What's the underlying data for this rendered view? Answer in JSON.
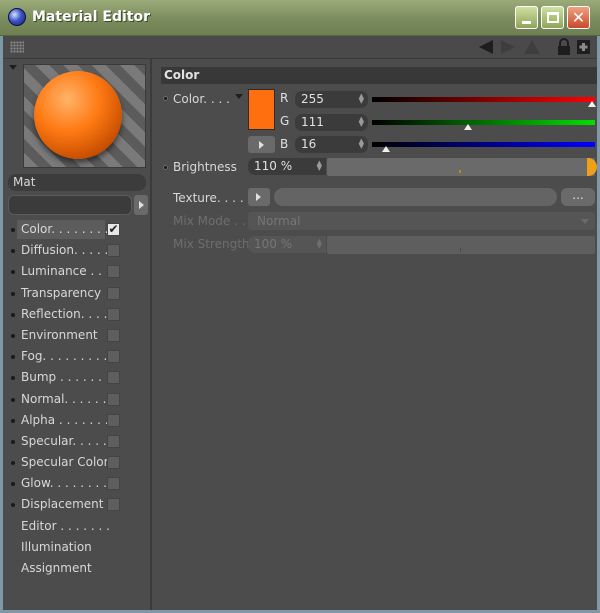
{
  "window": {
    "title": "Material Editor"
  },
  "toolbar": {
    "nav": [
      "back-arrow-icon",
      "forward-arrow-icon",
      "up-arrow-icon",
      "lock-icon",
      "new-window-icon"
    ]
  },
  "material": {
    "name": "Mat"
  },
  "channels": [
    {
      "label": "Color. . . . . . . .",
      "checked": true,
      "selected": true,
      "has_checkbox": true
    },
    {
      "label": "Diffusion. . . . . .",
      "checked": false,
      "has_checkbox": true
    },
    {
      "label": "Luminance . . .",
      "checked": false,
      "has_checkbox": true
    },
    {
      "label": "Transparency",
      "checked": false,
      "has_checkbox": true
    },
    {
      "label": "Reflection. . . .",
      "checked": false,
      "has_checkbox": true
    },
    {
      "label": "Environment",
      "checked": false,
      "has_checkbox": true
    },
    {
      "label": "Fog. . . . . . . . .",
      "checked": false,
      "has_checkbox": true
    },
    {
      "label": "Bump . . . . . . .",
      "checked": false,
      "has_checkbox": true
    },
    {
      "label": "Normal. . . . . .",
      "checked": false,
      "has_checkbox": true
    },
    {
      "label": "Alpha . . . . . . .",
      "checked": false,
      "has_checkbox": true
    },
    {
      "label": "Specular. . . . .",
      "checked": false,
      "has_checkbox": true
    },
    {
      "label": "Specular Color",
      "checked": false,
      "has_checkbox": true
    },
    {
      "label": "Glow. . . . . . . .",
      "checked": false,
      "has_checkbox": true
    },
    {
      "label": "Displacement",
      "checked": false,
      "has_checkbox": true
    },
    {
      "label": "Editor . . . . . . .",
      "has_checkbox": false
    },
    {
      "label": "Illumination",
      "has_checkbox": false
    },
    {
      "label": "Assignment",
      "has_checkbox": false
    }
  ],
  "color_section": {
    "title": "Color",
    "color_label": "Color. . . .",
    "swatch_color": "#ff6f10",
    "r_label": "R",
    "g_label": "G",
    "b_label": "B",
    "r": "255",
    "g": "111",
    "b": "16",
    "brightness_label": "Brightness",
    "brightness": "110 %",
    "texture_label": "Texture. . . .",
    "texture_dots": "...",
    "mix_mode_label": "Mix Mode . .",
    "mix_mode": "Normal",
    "mix_strength_label": "Mix Strength",
    "mix_strength": "100 %"
  }
}
